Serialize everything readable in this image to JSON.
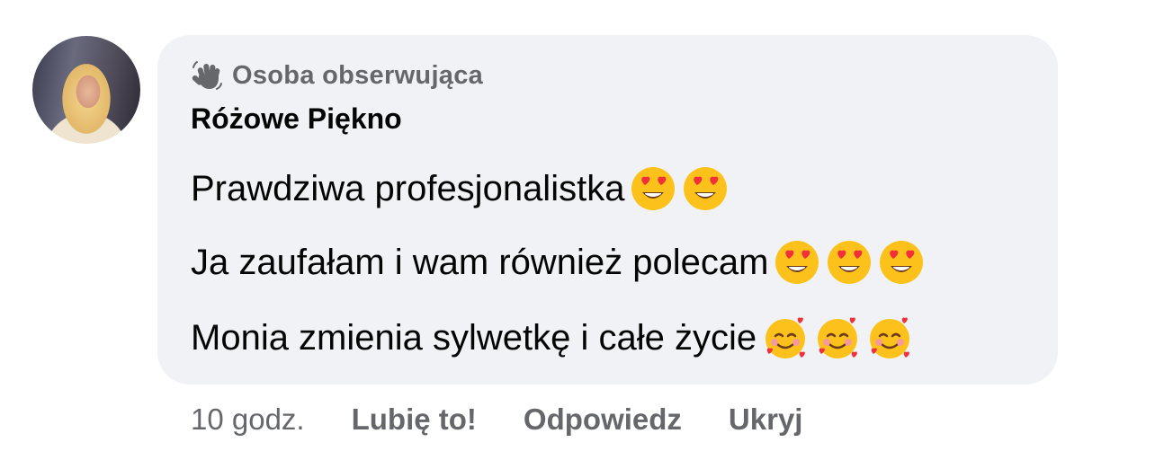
{
  "comment": {
    "badge": "Osoba obserwująca",
    "author": "Różowe Piękno",
    "lines": [
      "Prawdziwa profesjonalistka",
      "Ja zaufałam i wam również polecam",
      "Monia zmienia sylwetkę i całe życie"
    ]
  },
  "emojis": {
    "line1": [
      "heart-eyes-emoji",
      "heart-eyes-emoji"
    ],
    "line2": [
      "heart-eyes-emoji",
      "heart-eyes-emoji",
      "heart-eyes-emoji"
    ],
    "line3": [
      "smiling-face-with-hearts-emoji",
      "smiling-face-with-hearts-emoji",
      "smiling-face-with-hearts-emoji"
    ]
  },
  "actions": {
    "time": "10 godz.",
    "like": "Lubię to!",
    "reply": "Odpowiedz",
    "hide": "Ukryj"
  },
  "colors": {
    "bubble": "#f0f2f5",
    "secondary_text": "#65676b",
    "primary_text": "#050505"
  }
}
